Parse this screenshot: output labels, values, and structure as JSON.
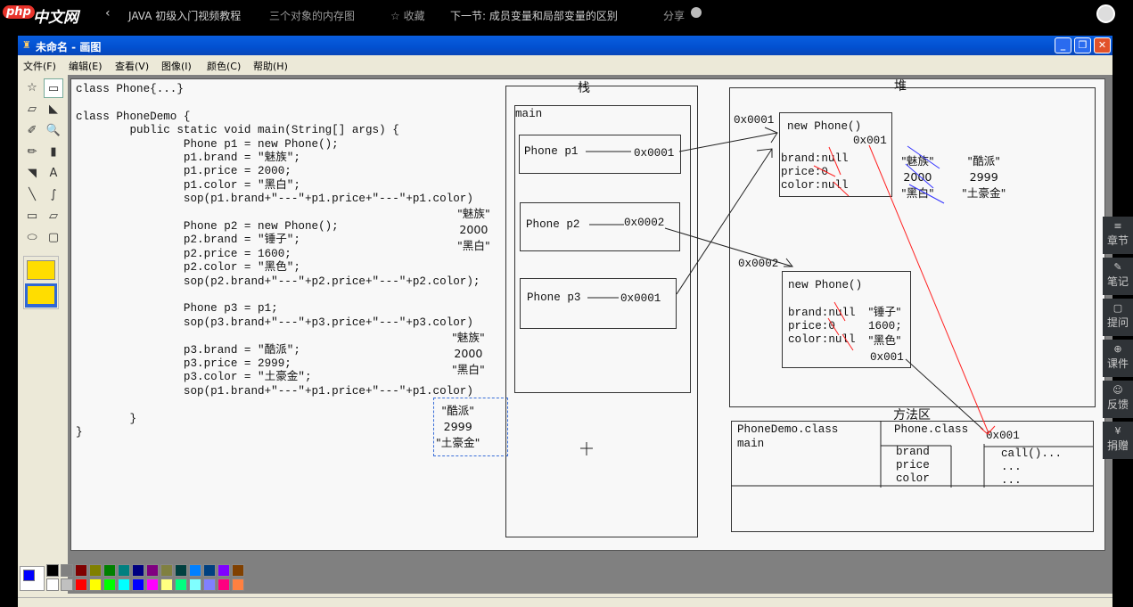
{
  "topbar": {
    "logo_php": "php",
    "logo_cn": "中文网",
    "back_icon": "chevron-left",
    "course": "JAVA 初级入门视频教程",
    "lesson": "三个对象的内存图",
    "favorite": "☆ 收藏",
    "next": "下一节: 成员变量和局部变量的区别",
    "share": "分享"
  },
  "window": {
    "title": "未命名 - 画图",
    "menu": [
      "文件(F)",
      "编辑(E)",
      "查看(V)",
      "图像(I)",
      "颜色(C)",
      "帮助(H)"
    ]
  },
  "tools": [
    "free-select",
    "rect-select",
    "eraser",
    "fill",
    "color-picker",
    "magnifier",
    "pencil",
    "brush",
    "airbrush",
    "text",
    "line",
    "curve",
    "rectangle",
    "polygon",
    "ellipse",
    "rounded-rect"
  ],
  "code": [
    "class Phone{...}",
    "",
    "class PhoneDemo {",
    "        public static void main(String[] args) {",
    "                Phone p1 = new Phone();",
    "                p1.brand = \"魅族\";",
    "                p1.price = 2000;",
    "                p1.color = \"黑白\";",
    "                sop(p1.brand+\"---\"+p1.price+\"---\"+p1.color)",
    "",
    "                Phone p2 = new Phone();",
    "                p2.brand = \"锤子\";",
    "                p2.price = 1600;",
    "                p2.color = \"黑色\";",
    "                sop(p2.brand+\"---\"+p2.price+\"---\"+p2.color);",
    "",
    "                Phone p3 = p1;",
    "                sop(p3.brand+\"---\"+p3.price+\"---\"+p3.color)",
    "",
    "                p3.brand = \"酷派\";",
    "                p3.price = 2999;",
    "                p3.color = \"土豪金\";",
    "                sop(p1.brand+\"---\"+p1.price+\"---\"+p1.color)",
    "",
    "        }",
    "}"
  ],
  "outputs": [
    [
      "\"魅族\"",
      "2000",
      "\"黑白\""
    ],
    [
      "\"魅族\"",
      "2000",
      "\"黑白\""
    ],
    [
      "\"酷派\"",
      "2999",
      "\"土豪金\""
    ]
  ],
  "stack": {
    "title": "栈",
    "frame": "main",
    "vars": [
      {
        "name": "Phone p1",
        "addr": "0x0001"
      },
      {
        "name": "Phone p2",
        "addr": "0x0002"
      },
      {
        "name": "Phone p3",
        "addr": "0x0001"
      }
    ]
  },
  "heap": {
    "title": "堆",
    "objects": [
      {
        "addr": "0x0001",
        "ctor": "new Phone()",
        "class_ref": "0x001",
        "fields": [
          "brand:null",
          "price:0",
          "color:null"
        ]
      },
      {
        "addr": "0x0002",
        "ctor": "new Phone()",
        "class_ref": "0x001",
        "fields": [
          "brand:null",
          "price:0",
          "color:null"
        ],
        "values": [
          "\"锤子\"",
          "1600;",
          "\"黑色\""
        ]
      }
    ],
    "old_values": [
      "\"魅族\"",
      "2000",
      "\"黑白\""
    ],
    "new_values": [
      "\"酷派\"",
      "2999",
      "\"土豪金\""
    ]
  },
  "method_area": {
    "title": "方法区",
    "demo_class": "PhoneDemo.class",
    "demo_method": "main",
    "phone_class": "Phone.class",
    "addr": "0x001",
    "fields": [
      "brand",
      "price",
      "color"
    ],
    "methods": [
      "call()...",
      "...",
      "..."
    ]
  },
  "palette": {
    "fg": "#0000ff",
    "colors": [
      "#000000",
      "#808080",
      "#800000",
      "#808000",
      "#008000",
      "#008080",
      "#000080",
      "#800080",
      "#808040",
      "#004040",
      "#0080ff",
      "#004080",
      "#8000ff",
      "#804000",
      "#ffffff",
      "#c0c0c0",
      "#ff0000",
      "#ffff00",
      "#00ff00",
      "#00ffff",
      "#0000ff",
      "#ff00ff",
      "#ffff80",
      "#00ff80",
      "#80ffff",
      "#8080ff",
      "#ff0080",
      "#ff8040"
    ]
  },
  "sidebar": [
    "章节",
    "笔记",
    "提问",
    "课件",
    "反馈",
    "捐赠"
  ],
  "sidebar_icons": [
    "≡",
    "✎",
    "▢",
    "⊕",
    "☺",
    "¥"
  ]
}
